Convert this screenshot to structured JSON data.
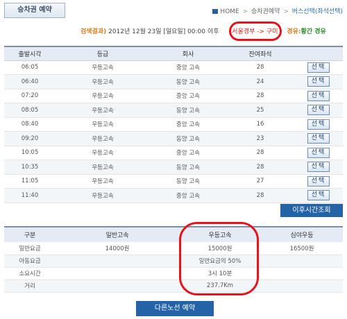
{
  "header": {
    "title": "승차권 예약"
  },
  "breadcrumb": {
    "home": "HOME",
    "sep": ">",
    "step1": "승차권예약",
    "current": "버스선택(좌석선택)"
  },
  "search_info": {
    "label": "검색결과)",
    "date": "2012년 12월 23일 [일요일] 00:00 이후",
    "route": "서울경부 -> 구미",
    "via_label": "경유:",
    "via_value": "황간 경유"
  },
  "bus_table": {
    "columns": [
      "출발시각",
      "등급",
      "회사",
      "잔여좌석",
      ""
    ],
    "select_label": "선택",
    "rows": [
      {
        "time": "06:05",
        "grade": "우등고속",
        "company": "중앙 고속",
        "seats": "28"
      },
      {
        "time": "06:40",
        "grade": "우등고속",
        "company": "동양 고속",
        "seats": "24"
      },
      {
        "time": "07:20",
        "grade": "우등고속",
        "company": "중앙 고속",
        "seats": "28"
      },
      {
        "time": "08:05",
        "grade": "우등고속",
        "company": "동양 고속",
        "seats": "25"
      },
      {
        "time": "08:40",
        "grade": "우등고속",
        "company": "중앙 고속",
        "seats": "16"
      },
      {
        "time": "09:20",
        "grade": "우등고속",
        "company": "동양 고속",
        "seats": "23"
      },
      {
        "time": "10:05",
        "grade": "우등고속",
        "company": "중앙 고속",
        "seats": "28"
      },
      {
        "time": "10:35",
        "grade": "우등고속",
        "company": "동양 고속",
        "seats": "28"
      },
      {
        "time": "11:05",
        "grade": "우등고속",
        "company": "동양 고속",
        "seats": "27"
      },
      {
        "time": "11:40",
        "grade": "우등고속",
        "company": "중앙 고속",
        "seats": "28"
      }
    ]
  },
  "next_time_button": "이후시간조회",
  "fare_table": {
    "columns": [
      "구분",
      "일반고속",
      "우등고속",
      "심야우등"
    ],
    "rows": [
      {
        "label": "일반요금",
        "general": "14000원",
        "premium": "15000원",
        "night": "16500원"
      },
      {
        "label": "아동요금",
        "general": "",
        "premium": "일반요금의 50%",
        "night": ""
      },
      {
        "label": "소요시간",
        "general": "",
        "premium": "3시 10분",
        "night": ""
      },
      {
        "label": "거리",
        "general": "",
        "premium": "237.7Km",
        "night": ""
      }
    ]
  },
  "other_route_button": "다른노선 예약"
}
